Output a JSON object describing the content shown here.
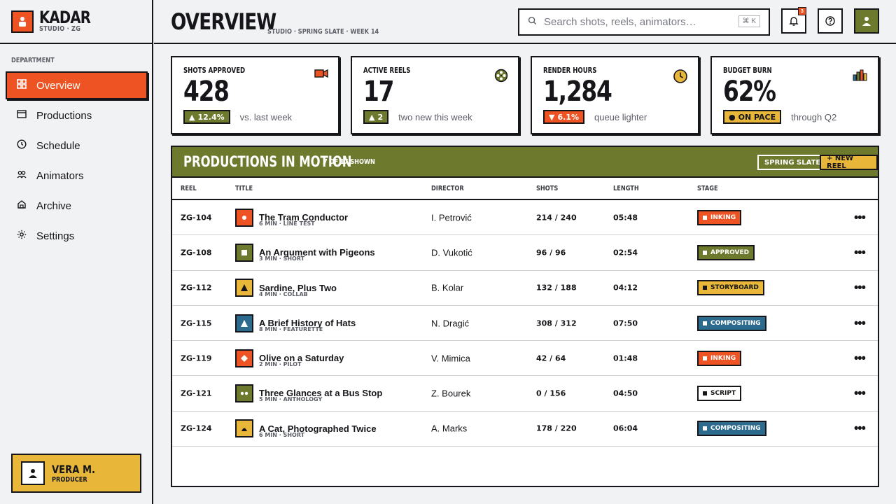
{
  "brand": {
    "name": "KADAR",
    "sub": "STUDIO · ZG"
  },
  "sidebar": {
    "section_label": "DEPARTMENT",
    "items": [
      {
        "label": "Overview",
        "icon": "grid-icon",
        "active": true
      },
      {
        "label": "Productions",
        "icon": "window-icon",
        "active": false
      },
      {
        "label": "Schedule",
        "icon": "clock-icon",
        "active": false
      },
      {
        "label": "Animators",
        "icon": "people-icon",
        "active": false
      },
      {
        "label": "Archive",
        "icon": "archive-icon",
        "active": false
      },
      {
        "label": "Settings",
        "icon": "gear-icon",
        "active": false
      }
    ],
    "user": {
      "name": "VERA M.",
      "role": "PRODUCER"
    }
  },
  "header": {
    "title": "OVERVIEW",
    "subtitle": "STUDIO · SPRING SLATE · WEEK 14",
    "search_placeholder": "Search shots, reels, animators…",
    "search_shortcut": "⌘ K",
    "notification_count": "3"
  },
  "kpis": [
    {
      "label": "SHOTS APPROVED",
      "value": "428",
      "delta": "12.4%",
      "delta_dir": "up",
      "note": "vs. last week",
      "icon": "camera-icon"
    },
    {
      "label": "ACTIVE REELS",
      "value": "17",
      "delta": "2",
      "delta_dir": "up",
      "note": "two new this week",
      "icon": "film-reel-icon"
    },
    {
      "label": "RENDER HOURS",
      "value": "1,284",
      "delta": "6.1%",
      "delta_dir": "down",
      "note": "queue lighter",
      "icon": "clock-icon"
    },
    {
      "label": "BUDGET BURN",
      "value": "62%",
      "delta": "ON PACE",
      "delta_dir": "pace",
      "note": "through Q2",
      "icon": "bar-chart-icon"
    }
  ],
  "productions": {
    "title": "PRODUCTIONS IN MOTION",
    "count": "7 OF 17 SHOWN",
    "filter_chip": "SPRING SLATE",
    "new_button": "+ NEW REEL",
    "columns": [
      "REEL",
      "TITLE",
      "DIRECTOR",
      "SHOTS",
      "LENGTH",
      "STAGE"
    ],
    "rows": [
      {
        "reel": "ZG-104",
        "title": "The Tram Conductor",
        "meta": "6 MIN · LINE TEST",
        "director": "I. Petrović",
        "shots": "214 / 240",
        "length": "05:48",
        "stage": "INKING",
        "thumb_color": "#ee5423",
        "thumb_shape": "circle"
      },
      {
        "reel": "ZG-108",
        "title": "An Argument with Pigeons",
        "meta": "3 MIN · SHORT",
        "director": "D. Vukotić",
        "shots": "96 / 96",
        "length": "02:54",
        "stage": "APPROVED",
        "thumb_color": "#6d7a2e",
        "thumb_shape": "square"
      },
      {
        "reel": "ZG-112",
        "title": "Sardine, Plus Two",
        "meta": "4 MIN · COLLAB",
        "director": "B. Kolar",
        "shots": "132 / 188",
        "length": "04:12",
        "stage": "STORYBOARD",
        "thumb_color": "#e8b73a",
        "thumb_shape": "triangle"
      },
      {
        "reel": "ZG-115",
        "title": "A Brief History of Hats",
        "meta": "8 MIN · FEATURETTE",
        "director": "N. Dragić",
        "shots": "308 / 312",
        "length": "07:50",
        "stage": "COMPOSITING",
        "thumb_color": "#2c6a8e",
        "thumb_shape": "triangle-white"
      },
      {
        "reel": "ZG-119",
        "title": "Olive on a Saturday",
        "meta": "2 MIN · PILOT",
        "director": "V. Mimica",
        "shots": "42 / 64",
        "length": "01:48",
        "stage": "INKING",
        "thumb_color": "#ee5423",
        "thumb_shape": "diamond"
      },
      {
        "reel": "ZG-121",
        "title": "Three Glances at a Bus Stop",
        "meta": "5 MIN · ANTHOLOGY",
        "director": "Z. Bourek",
        "shots": "0 / 156",
        "length": "04:50",
        "stage": "SCRIPT",
        "thumb_color": "#6d7a2e",
        "thumb_shape": "dots"
      },
      {
        "reel": "ZG-124",
        "title": "A Cat, Photographed Twice",
        "meta": "6 MIN · SHORT",
        "director": "A. Marks",
        "shots": "178 / 220",
        "length": "06:04",
        "stage": "COMPOSITING",
        "thumb_color": "#e8b73a",
        "thumb_shape": "dome"
      }
    ]
  },
  "stage_styles": {
    "INKING": {
      "bg": "#ee5423",
      "fg": "#ffffff",
      "sq": "#ffffff"
    },
    "APPROVED": {
      "bg": "#6d7a2e",
      "fg": "#ffffff",
      "sq": "#ffffff"
    },
    "STORYBOARD": {
      "bg": "#e8b73a",
      "fg": "#16161a",
      "sq": "#16161a"
    },
    "COMPOSITING": {
      "bg": "#2c6a8e",
      "fg": "#ffffff",
      "sq": "#ffffff"
    },
    "SCRIPT": {
      "bg": "#ffffff",
      "fg": "#16161a",
      "sq": "#16161a"
    }
  },
  "colors": {
    "accent": "#ee5423",
    "olive": "#6d7a2e",
    "mustard": "#e8b73a",
    "blue": "#2c6a8e",
    "ink": "#16161a"
  }
}
